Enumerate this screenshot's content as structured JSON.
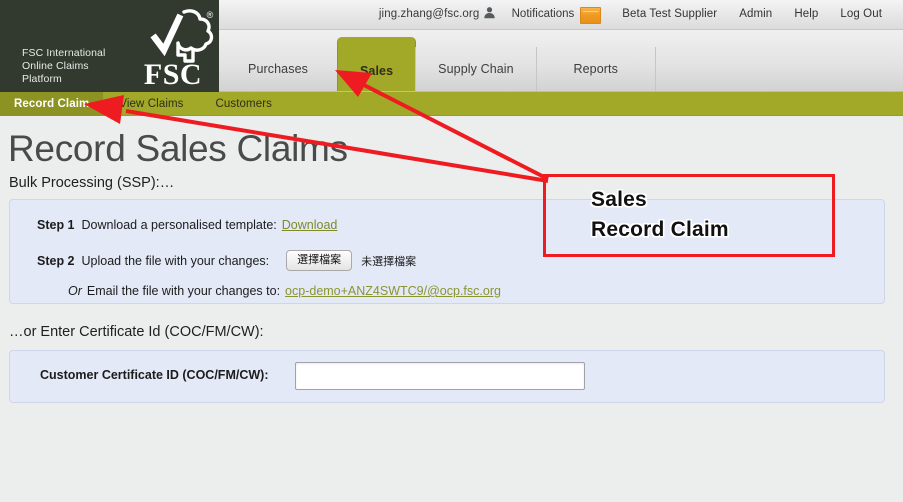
{
  "topbar": {
    "user_email": "jing.zhang@fsc.org",
    "user_icon": "person-icon",
    "notifications_label": "Notifications",
    "notifications_icon": "notification-flag-icon",
    "items": [
      {
        "label": "Beta Test Supplier"
      },
      {
        "label": "Admin"
      },
      {
        "label": "Help"
      },
      {
        "label": "Log Out"
      }
    ]
  },
  "logo": {
    "line1": "FSC International",
    "line2": "Online Claims",
    "line3": "Platform",
    "wordmark": "FSC",
    "registered_mark": "®",
    "icon": "fsc-checkmark-tree-logo"
  },
  "primary_nav": {
    "tabs": [
      {
        "label": "Purchases",
        "active": false
      },
      {
        "label": "Sales",
        "active": true
      },
      {
        "label": "Supply Chain",
        "active": false
      },
      {
        "label": "Reports",
        "active": false
      }
    ]
  },
  "secondary_nav": {
    "items": [
      {
        "label": "Record Claim",
        "active": true
      },
      {
        "label": "View Claims",
        "active": false
      },
      {
        "label": "Customers",
        "active": false
      }
    ]
  },
  "main": {
    "page_title": "Record Sales Claims",
    "bulk_section_label": "Bulk Processing (SSP):…",
    "steps": [
      {
        "label": "Step 1",
        "text": "Download a personalised template:",
        "link": "Download"
      },
      {
        "label": "Step 2",
        "text": "Upload the file with your changes:",
        "choose_file_button": "選擇檔案",
        "file_status": "未選擇檔案"
      }
    ],
    "email_row": {
      "or_word": "Or",
      "text": "Email the file with your changes to:",
      "link": "ocp-demo+ANZ4SWTC9/@ocp.fsc.org"
    },
    "cert_section_label": "…or Enter Certificate Id (COC/FM/CW):",
    "cert_field_label": "Customer Certificate ID (COC/FM/CW):",
    "cert_field_value": "",
    "cert_field_placeholder": ""
  },
  "annotation": {
    "line1": "Sales",
    "line2": "Record Claim",
    "box_color": "#ee1c20",
    "arrow_color": "#ee1c20",
    "arrow_targets": [
      "sales-tab",
      "record-claim-subnav-item"
    ]
  },
  "colors": {
    "olive": "#a2a827",
    "olive_dark": "#8d9322",
    "header_dark_green": "#323a30",
    "panel_blue": "#e4e9f7",
    "page_bg": "#eceded",
    "link_olive": "#7e8a2c",
    "annotation_red": "#ee1c20",
    "notification_orange": "#ef9a22"
  }
}
